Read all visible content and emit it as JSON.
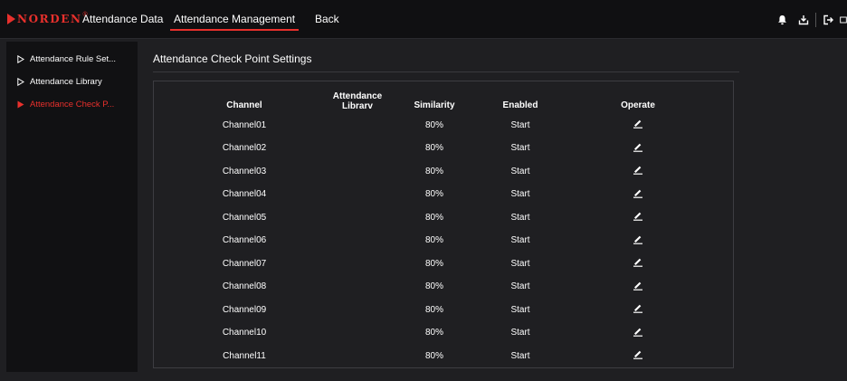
{
  "header": {
    "logo_text": "NORDEN",
    "logo_reg": "®",
    "nav": [
      {
        "label": "Attendance Data"
      },
      {
        "label": "Attendance Management",
        "active": true
      },
      {
        "label": "Back"
      }
    ],
    "icons": [
      "bell-icon",
      "download-icon",
      "logout-icon",
      "fullscreen-icon"
    ]
  },
  "sidebar": {
    "items": [
      {
        "label": "Attendance Rule Set...",
        "active": false
      },
      {
        "label": "Attendance Library",
        "active": false
      },
      {
        "label": "Attendance Check P...",
        "active": true
      }
    ]
  },
  "main": {
    "title": "Attendance Check Point Settings",
    "columns": {
      "channel": "Channel",
      "library": "Attendance Librarv",
      "similarity": "Similarity",
      "enabled": "Enabled",
      "operate": "Operate"
    },
    "rows": [
      {
        "channel": "Channel01",
        "library": "",
        "similarity": "80%",
        "enabled": "Start"
      },
      {
        "channel": "Channel02",
        "library": "",
        "similarity": "80%",
        "enabled": "Start"
      },
      {
        "channel": "Channel03",
        "library": "",
        "similarity": "80%",
        "enabled": "Start"
      },
      {
        "channel": "Channel04",
        "library": "",
        "similarity": "80%",
        "enabled": "Start"
      },
      {
        "channel": "Channel05",
        "library": "",
        "similarity": "80%",
        "enabled": "Start"
      },
      {
        "channel": "Channel06",
        "library": "",
        "similarity": "80%",
        "enabled": "Start"
      },
      {
        "channel": "Channel07",
        "library": "",
        "similarity": "80%",
        "enabled": "Start"
      },
      {
        "channel": "Channel08",
        "library": "",
        "similarity": "80%",
        "enabled": "Start"
      },
      {
        "channel": "Channel09",
        "library": "",
        "similarity": "80%",
        "enabled": "Start"
      },
      {
        "channel": "Channel10",
        "library": "",
        "similarity": "80%",
        "enabled": "Start"
      },
      {
        "channel": "Channel11",
        "library": "",
        "similarity": "80%",
        "enabled": "Start"
      }
    ]
  },
  "colors": {
    "accent": "#e8302c",
    "background": "#1f1f22",
    "topbar": "#101012",
    "sidebar": "#111113"
  }
}
